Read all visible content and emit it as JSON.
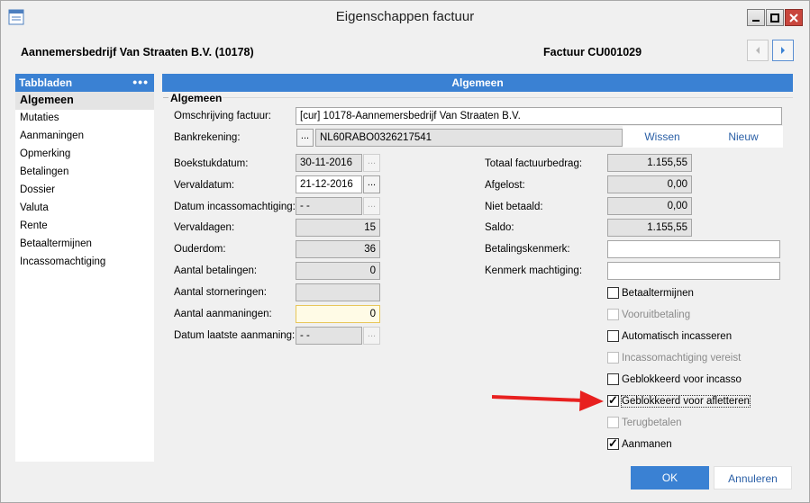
{
  "window": {
    "title": "Eigenschappen factuur"
  },
  "header": {
    "company": "Aannemersbedrijf Van Straaten B.V. (10178)",
    "invoice": "Factuur CU001029"
  },
  "sidebar": {
    "title": "Tabbladen",
    "menu_glyph": "•••",
    "items": [
      {
        "label": "Algemeen"
      },
      {
        "label": "Mutaties"
      },
      {
        "label": "Aanmaningen"
      },
      {
        "label": "Opmerking"
      },
      {
        "label": "Betalingen"
      },
      {
        "label": "Dossier"
      },
      {
        "label": "Valuta"
      },
      {
        "label": "Rente"
      },
      {
        "label": "Betaaltermijnen"
      },
      {
        "label": "Incassomachtiging"
      }
    ]
  },
  "panel": {
    "title": "Algemeen",
    "section": "Algemeen"
  },
  "form": {
    "omschrijving_label": "Omschrijving factuur:",
    "omschrijving_value": "[cur] 10178-Aannemersbedrijf Van Straaten B.V.",
    "bank_label": "Bankrekening:",
    "bank_value": "NL60RABO0326217541",
    "wissen": "Wissen",
    "nieuw": "Nieuw",
    "boekstuk_label": "Boekstukdatum:",
    "boekstuk_value": "30-11-2016",
    "verval_label": "Vervaldatum:",
    "verval_value": "21-12-2016",
    "incasso_datum_label": "Datum incassomachtiging:",
    "incasso_datum_value": "-  -",
    "vervaldagen_label": "Vervaldagen:",
    "vervaldagen_value": "15",
    "ouderdom_label": "Ouderdom:",
    "ouderdom_value": "36",
    "aantal_betalingen_label": "Aantal betalingen:",
    "aantal_betalingen_value": "0",
    "aantal_stornering_label": "Aantal storneringen:",
    "aantal_stornering_value": "",
    "aantal_aanmaningen_label": "Aantal aanmaningen:",
    "aantal_aanmaningen_value": "0",
    "laatste_aanmaning_label": "Datum laatste aanmaning:",
    "laatste_aanmaning_value": "-  -",
    "totaal_label": "Totaal factuurbedrag:",
    "totaal_value": "1.155,55",
    "afgelost_label": "Afgelost:",
    "afgelost_value": "0,00",
    "niet_betaald_label": "Niet betaald:",
    "niet_betaald_value": "0,00",
    "saldo_label": "Saldo:",
    "saldo_value": "1.155,55",
    "betalingskenmerk_label": "Betalingskenmerk:",
    "betalingskenmerk_value": "",
    "kenmerk_machtiging_label": "Kenmerk machtiging:",
    "kenmerk_machtiging_value": ""
  },
  "checkboxes": [
    {
      "label": "Betaaltermijnen",
      "checked": false,
      "disabled": false
    },
    {
      "label": "Vooruitbetaling",
      "checked": false,
      "disabled": true
    },
    {
      "label": "Automatisch incasseren",
      "checked": false,
      "disabled": false
    },
    {
      "label": "Incassomachtiging vereist",
      "checked": false,
      "disabled": true
    },
    {
      "label": "Geblokkeerd voor incasso",
      "checked": false,
      "disabled": false
    },
    {
      "label": "Geblokkeerd voor afletteren",
      "checked": true,
      "disabled": false
    },
    {
      "label": "Terugbetalen",
      "checked": false,
      "disabled": true
    },
    {
      "label": "Aanmanen",
      "checked": true,
      "disabled": false
    }
  ],
  "footer": {
    "ok": "OK",
    "cancel": "Annuleren"
  },
  "colors": {
    "accent": "#3a81d3",
    "arrow": "#e8201f"
  }
}
